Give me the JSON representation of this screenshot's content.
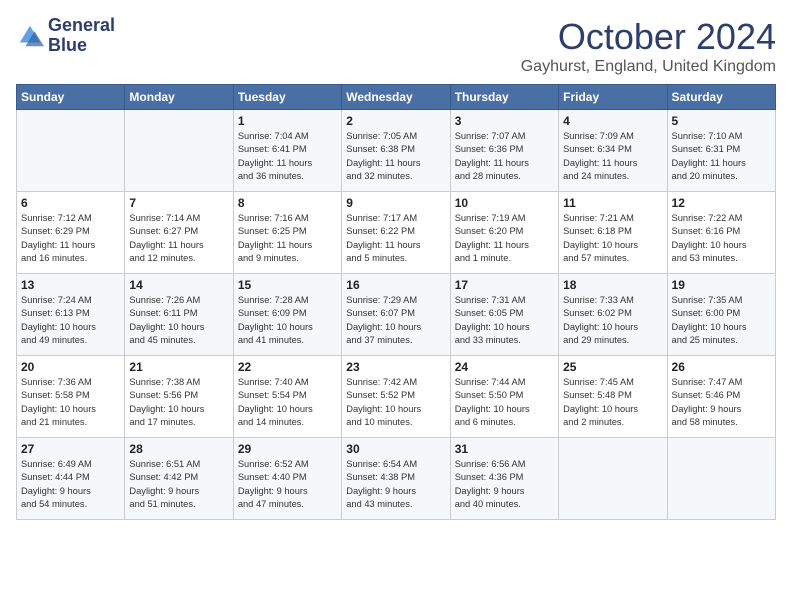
{
  "header": {
    "logo_line1": "General",
    "logo_line2": "Blue",
    "month_title": "October 2024",
    "location": "Gayhurst, England, United Kingdom"
  },
  "weekdays": [
    "Sunday",
    "Monday",
    "Tuesday",
    "Wednesday",
    "Thursday",
    "Friday",
    "Saturday"
  ],
  "weeks": [
    [
      {
        "day": "",
        "info": ""
      },
      {
        "day": "",
        "info": ""
      },
      {
        "day": "1",
        "info": "Sunrise: 7:04 AM\nSunset: 6:41 PM\nDaylight: 11 hours\nand 36 minutes."
      },
      {
        "day": "2",
        "info": "Sunrise: 7:05 AM\nSunset: 6:38 PM\nDaylight: 11 hours\nand 32 minutes."
      },
      {
        "day": "3",
        "info": "Sunrise: 7:07 AM\nSunset: 6:36 PM\nDaylight: 11 hours\nand 28 minutes."
      },
      {
        "day": "4",
        "info": "Sunrise: 7:09 AM\nSunset: 6:34 PM\nDaylight: 11 hours\nand 24 minutes."
      },
      {
        "day": "5",
        "info": "Sunrise: 7:10 AM\nSunset: 6:31 PM\nDaylight: 11 hours\nand 20 minutes."
      }
    ],
    [
      {
        "day": "6",
        "info": "Sunrise: 7:12 AM\nSunset: 6:29 PM\nDaylight: 11 hours\nand 16 minutes."
      },
      {
        "day": "7",
        "info": "Sunrise: 7:14 AM\nSunset: 6:27 PM\nDaylight: 11 hours\nand 12 minutes."
      },
      {
        "day": "8",
        "info": "Sunrise: 7:16 AM\nSunset: 6:25 PM\nDaylight: 11 hours\nand 9 minutes."
      },
      {
        "day": "9",
        "info": "Sunrise: 7:17 AM\nSunset: 6:22 PM\nDaylight: 11 hours\nand 5 minutes."
      },
      {
        "day": "10",
        "info": "Sunrise: 7:19 AM\nSunset: 6:20 PM\nDaylight: 11 hours\nand 1 minute."
      },
      {
        "day": "11",
        "info": "Sunrise: 7:21 AM\nSunset: 6:18 PM\nDaylight: 10 hours\nand 57 minutes."
      },
      {
        "day": "12",
        "info": "Sunrise: 7:22 AM\nSunset: 6:16 PM\nDaylight: 10 hours\nand 53 minutes."
      }
    ],
    [
      {
        "day": "13",
        "info": "Sunrise: 7:24 AM\nSunset: 6:13 PM\nDaylight: 10 hours\nand 49 minutes."
      },
      {
        "day": "14",
        "info": "Sunrise: 7:26 AM\nSunset: 6:11 PM\nDaylight: 10 hours\nand 45 minutes."
      },
      {
        "day": "15",
        "info": "Sunrise: 7:28 AM\nSunset: 6:09 PM\nDaylight: 10 hours\nand 41 minutes."
      },
      {
        "day": "16",
        "info": "Sunrise: 7:29 AM\nSunset: 6:07 PM\nDaylight: 10 hours\nand 37 minutes."
      },
      {
        "day": "17",
        "info": "Sunrise: 7:31 AM\nSunset: 6:05 PM\nDaylight: 10 hours\nand 33 minutes."
      },
      {
        "day": "18",
        "info": "Sunrise: 7:33 AM\nSunset: 6:02 PM\nDaylight: 10 hours\nand 29 minutes."
      },
      {
        "day": "19",
        "info": "Sunrise: 7:35 AM\nSunset: 6:00 PM\nDaylight: 10 hours\nand 25 minutes."
      }
    ],
    [
      {
        "day": "20",
        "info": "Sunrise: 7:36 AM\nSunset: 5:58 PM\nDaylight: 10 hours\nand 21 minutes."
      },
      {
        "day": "21",
        "info": "Sunrise: 7:38 AM\nSunset: 5:56 PM\nDaylight: 10 hours\nand 17 minutes."
      },
      {
        "day": "22",
        "info": "Sunrise: 7:40 AM\nSunset: 5:54 PM\nDaylight: 10 hours\nand 14 minutes."
      },
      {
        "day": "23",
        "info": "Sunrise: 7:42 AM\nSunset: 5:52 PM\nDaylight: 10 hours\nand 10 minutes."
      },
      {
        "day": "24",
        "info": "Sunrise: 7:44 AM\nSunset: 5:50 PM\nDaylight: 10 hours\nand 6 minutes."
      },
      {
        "day": "25",
        "info": "Sunrise: 7:45 AM\nSunset: 5:48 PM\nDaylight: 10 hours\nand 2 minutes."
      },
      {
        "day": "26",
        "info": "Sunrise: 7:47 AM\nSunset: 5:46 PM\nDaylight: 9 hours\nand 58 minutes."
      }
    ],
    [
      {
        "day": "27",
        "info": "Sunrise: 6:49 AM\nSunset: 4:44 PM\nDaylight: 9 hours\nand 54 minutes."
      },
      {
        "day": "28",
        "info": "Sunrise: 6:51 AM\nSunset: 4:42 PM\nDaylight: 9 hours\nand 51 minutes."
      },
      {
        "day": "29",
        "info": "Sunrise: 6:52 AM\nSunset: 4:40 PM\nDaylight: 9 hours\nand 47 minutes."
      },
      {
        "day": "30",
        "info": "Sunrise: 6:54 AM\nSunset: 4:38 PM\nDaylight: 9 hours\nand 43 minutes."
      },
      {
        "day": "31",
        "info": "Sunrise: 6:56 AM\nSunset: 4:36 PM\nDaylight: 9 hours\nand 40 minutes."
      },
      {
        "day": "",
        "info": ""
      },
      {
        "day": "",
        "info": ""
      }
    ]
  ]
}
